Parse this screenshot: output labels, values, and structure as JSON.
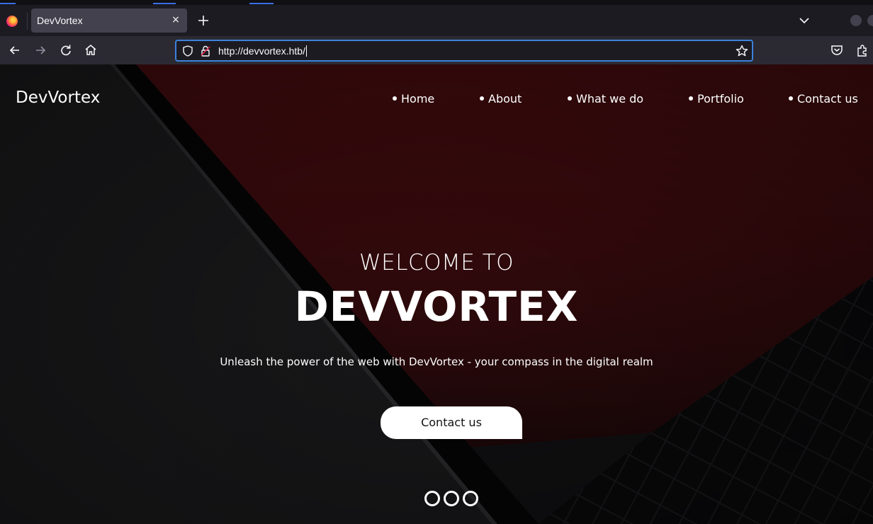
{
  "browser": {
    "tab": {
      "title": "DevVortex",
      "close_glyph": "×"
    },
    "url": "http://devvortex.htb/",
    "icons": [
      "firefox-logo",
      "close-icon",
      "plus-icon",
      "chevron-down-icon",
      "back-icon",
      "forward-icon",
      "reload-icon",
      "home-icon",
      "shield-icon",
      "lock-icon",
      "star-icon",
      "pocket-icon",
      "extensions-icon"
    ]
  },
  "site": {
    "brand": "DevVortex",
    "nav": [
      {
        "label": "Home"
      },
      {
        "label": "About"
      },
      {
        "label": "What we do"
      },
      {
        "label": "Portfolio"
      },
      {
        "label": "Contact us"
      }
    ],
    "hero": {
      "pre_title": "WELCOME TO",
      "title": "DEVVORTEX",
      "subtitle": "Unleash the power of the web with DevVortex - your compass in the digital realm",
      "cta": "Contact us"
    },
    "carousel": {
      "count": 3
    }
  },
  "colors": {
    "url_focus": "#3c82dc",
    "toolbar": "#2b2a33",
    "tab_active": "#42414d"
  }
}
